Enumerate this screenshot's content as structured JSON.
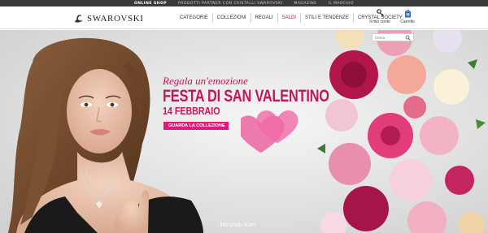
{
  "topbar": {
    "items": [
      {
        "label": "ONLINE SHOP",
        "active": true
      },
      {
        "label": "PRODOTTI PARTNER CON CRISTALLI SWAROVSKI",
        "active": false
      },
      {
        "label": "MAGAZINE",
        "active": false
      },
      {
        "label": "IL MARCHIO",
        "active": false
      }
    ]
  },
  "header": {
    "logo_text": "SWAROVSKI",
    "nav": [
      {
        "label": "CATEGORIE"
      },
      {
        "label": "COLLEZIONI"
      },
      {
        "label": "REGALI"
      },
      {
        "label": "SALDI",
        "highlight": true
      },
      {
        "label": "STILI E TENDENZE"
      },
      {
        "label": "CRYSTAL SOCIETY"
      }
    ],
    "account_label": "Il mio conto",
    "cart_label": "Carrello"
  },
  "search": {
    "placeholder": "Cerca"
  },
  "hero": {
    "tagline": "Regala un'emozione",
    "headline": "FESTA DI SAN VALENTINO",
    "date": "14 FEBBRAIO",
    "cta_label": "GUARDA LA COLLEZIONE",
    "caption": "Miranda Kerr"
  },
  "colors": {
    "accent_pink": "#e0197d",
    "headline_pink": "#c2185b",
    "sale_red": "#d0103a",
    "topbar_bg": "#3a3a3a"
  },
  "icons": {
    "logo": "swan-icon",
    "account": "key-icon",
    "cart": "shopping-bag-icon",
    "search": "search-icon",
    "cta": "arrow-right-icon"
  }
}
